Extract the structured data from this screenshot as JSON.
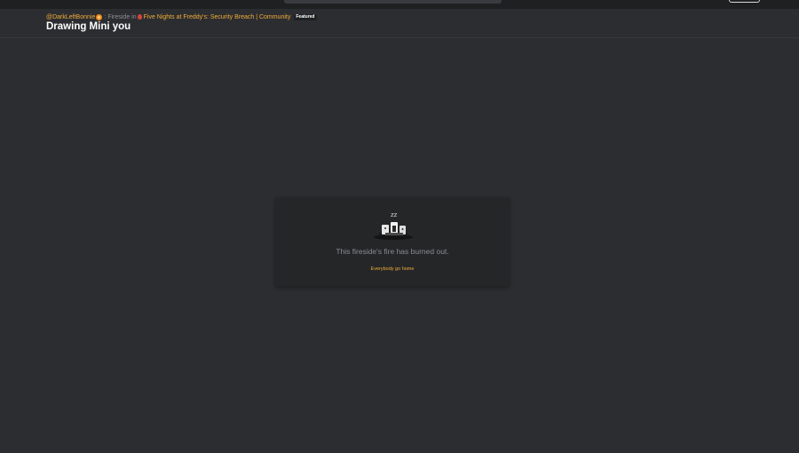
{
  "breadcrumb": {
    "username": "@DarkLeftBonnie",
    "separator": ":",
    "type_label": "Fireside in",
    "community": "Five Nights at Freddy's: Security Breach | Community",
    "badge": "Featured"
  },
  "page": {
    "title": "Drawing Mini you"
  },
  "fireside_status": {
    "message": "This fireside's fire has burned out.",
    "link_label": "Everybody go home",
    "illustration_icon": "sleeping-campfire-icon",
    "sleep_text": "zz"
  },
  "colors": {
    "accent": "#f0ad3a",
    "background": "#2c2d30",
    "card": "#252628",
    "topbar": "#1f2022"
  }
}
